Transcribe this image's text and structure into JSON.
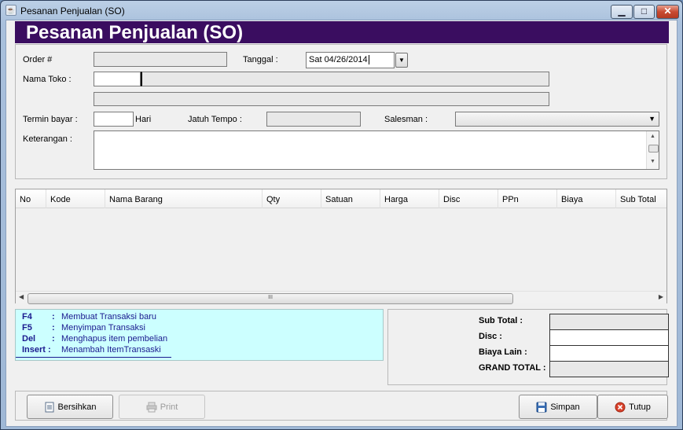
{
  "window": {
    "title": "Pesanan Penjualan (SO)"
  },
  "header": {
    "title": "Pesanan Penjualan (SO)"
  },
  "form": {
    "order_label": "Order #",
    "order_value": "",
    "tanggal_label": "Tanggal :",
    "tanggal_value": "Sat 04/26/2014",
    "toko_label": "Nama Toko :",
    "termin_label": "Termin bayar :",
    "termin_unit": "Hari",
    "jatuh_tempo_label": "Jatuh Tempo :",
    "salesman_label": "Salesman :",
    "keterangan_label": "Keterangan :"
  },
  "table": {
    "columns": [
      "No",
      "Kode",
      "Nama Barang",
      "Qty",
      "Satuan",
      "Harga",
      "Disc",
      "PPn",
      "Biaya",
      "Sub Total"
    ],
    "rows": [],
    "scroll_label": "III"
  },
  "shortcuts": [
    {
      "key": "F4",
      "desc": "Membuat Transaksi baru"
    },
    {
      "key": "F5",
      "desc": "Menyimpan Transaksi"
    },
    {
      "key": "Del",
      "desc": "Menghapus item pembelian"
    },
    {
      "key": "Insert :",
      "desc": "Menambah ItemTransaski"
    }
  ],
  "totals": {
    "sub_total_label": "Sub Total :",
    "disc_label": "Disc :",
    "biaya_lain_label": "Biaya Lain :",
    "grand_total_label": "GRAND TOTAL :"
  },
  "buttons": {
    "bersihkan": "Bersihkan",
    "print": "Print",
    "simpan": "Simpan",
    "tutup": "Tutup"
  },
  "colors": {
    "header_bg": "#3a0d60",
    "shortcut_bg": "#ccffff",
    "shortcut_text": "#1a1a8f"
  }
}
